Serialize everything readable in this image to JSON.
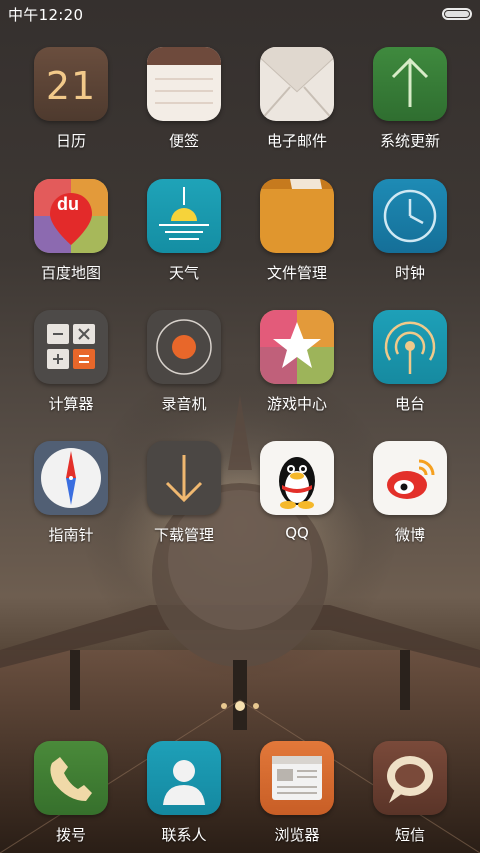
{
  "status_bar": {
    "time": "中午12:20"
  },
  "apps": [
    {
      "id": "calendar",
      "label": "日历",
      "icon": "calendar-icon",
      "badge_text": "21"
    },
    {
      "id": "notes",
      "label": "便签",
      "icon": "notes-icon"
    },
    {
      "id": "email",
      "label": "电子邮件",
      "icon": "email-icon"
    },
    {
      "id": "system-update",
      "label": "系统更新",
      "icon": "arrow-up-icon"
    },
    {
      "id": "baidu-map",
      "label": "百度地图",
      "icon": "baidu-map-icon",
      "badge_text": "du"
    },
    {
      "id": "weather",
      "label": "天气",
      "icon": "weather-icon"
    },
    {
      "id": "file-manager",
      "label": "文件管理",
      "icon": "folder-icon"
    },
    {
      "id": "clock",
      "label": "时钟",
      "icon": "clock-icon"
    },
    {
      "id": "calculator",
      "label": "计算器",
      "icon": "calculator-icon"
    },
    {
      "id": "recorder",
      "label": "录音机",
      "icon": "record-icon"
    },
    {
      "id": "game-center",
      "label": "游戏中心",
      "icon": "star-icon"
    },
    {
      "id": "radio",
      "label": "电台",
      "icon": "radio-icon"
    },
    {
      "id": "compass",
      "label": "指南针",
      "icon": "compass-icon"
    },
    {
      "id": "download-manager",
      "label": "下载管理",
      "icon": "download-icon"
    },
    {
      "id": "qq",
      "label": "QQ",
      "icon": "qq-penguin-icon"
    },
    {
      "id": "weibo",
      "label": "微博",
      "icon": "weibo-icon"
    }
  ],
  "dock": [
    {
      "id": "dialer",
      "label": "拨号",
      "icon": "phone-icon"
    },
    {
      "id": "contacts",
      "label": "联系人",
      "icon": "contact-icon"
    },
    {
      "id": "browser",
      "label": "浏览器",
      "icon": "browser-icon"
    },
    {
      "id": "messages",
      "label": "短信",
      "icon": "message-icon"
    }
  ]
}
